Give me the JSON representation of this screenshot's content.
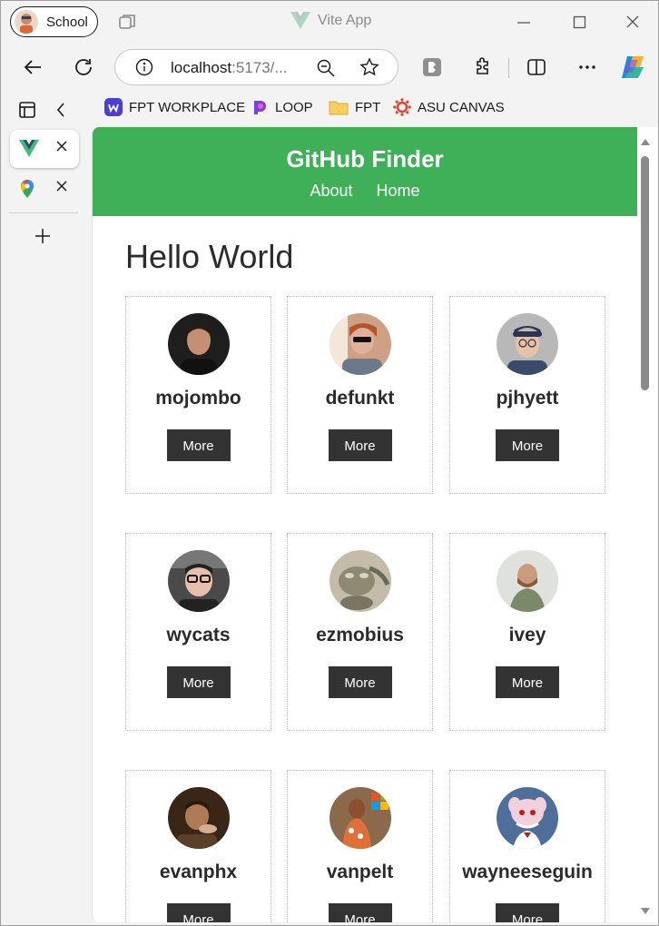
{
  "window": {
    "profile_label": "School",
    "title": "Vite App"
  },
  "nav": {
    "url_host": "localhost",
    "url_rest": ":5173/..."
  },
  "bookmarks": [
    {
      "label": "FPT WORKPLACE",
      "icon": "workplace-icon"
    },
    {
      "label": "LOOP",
      "icon": "loop-icon"
    },
    {
      "label": "FPT",
      "icon": "folder-icon"
    },
    {
      "label": "ASU CANVAS",
      "icon": "canvas-icon"
    }
  ],
  "sidebar": {
    "tabs": [
      {
        "icon": "vue-icon",
        "active": true
      },
      {
        "icon": "google-maps-icon",
        "active": false
      }
    ]
  },
  "page": {
    "brand": "GitHub Finder",
    "links": [
      "About",
      "Home"
    ],
    "title": "Hello World",
    "users": [
      {
        "login": "mojombo",
        "button": "More",
        "color": "#1e1e1e"
      },
      {
        "login": "defunkt",
        "button": "More",
        "color": "#b06a40"
      },
      {
        "login": "pjhyett",
        "button": "More",
        "color": "#6e7f8e"
      },
      {
        "login": "wycats",
        "button": "More",
        "color": "#3c3c3c"
      },
      {
        "login": "ezmobius",
        "button": "More",
        "color": "#8d8a78"
      },
      {
        "login": "ivey",
        "button": "More",
        "color": "#9aa08a"
      },
      {
        "login": "evanphx",
        "button": "More",
        "color": "#4a3420"
      },
      {
        "login": "vanpelt",
        "button": "More",
        "color": "#c56a3a"
      },
      {
        "login": "wayneeseguin",
        "button": "More",
        "color": "#4f6f9a"
      }
    ]
  },
  "colors": {
    "header_green": "#3fb057",
    "button_dark": "#333333"
  }
}
